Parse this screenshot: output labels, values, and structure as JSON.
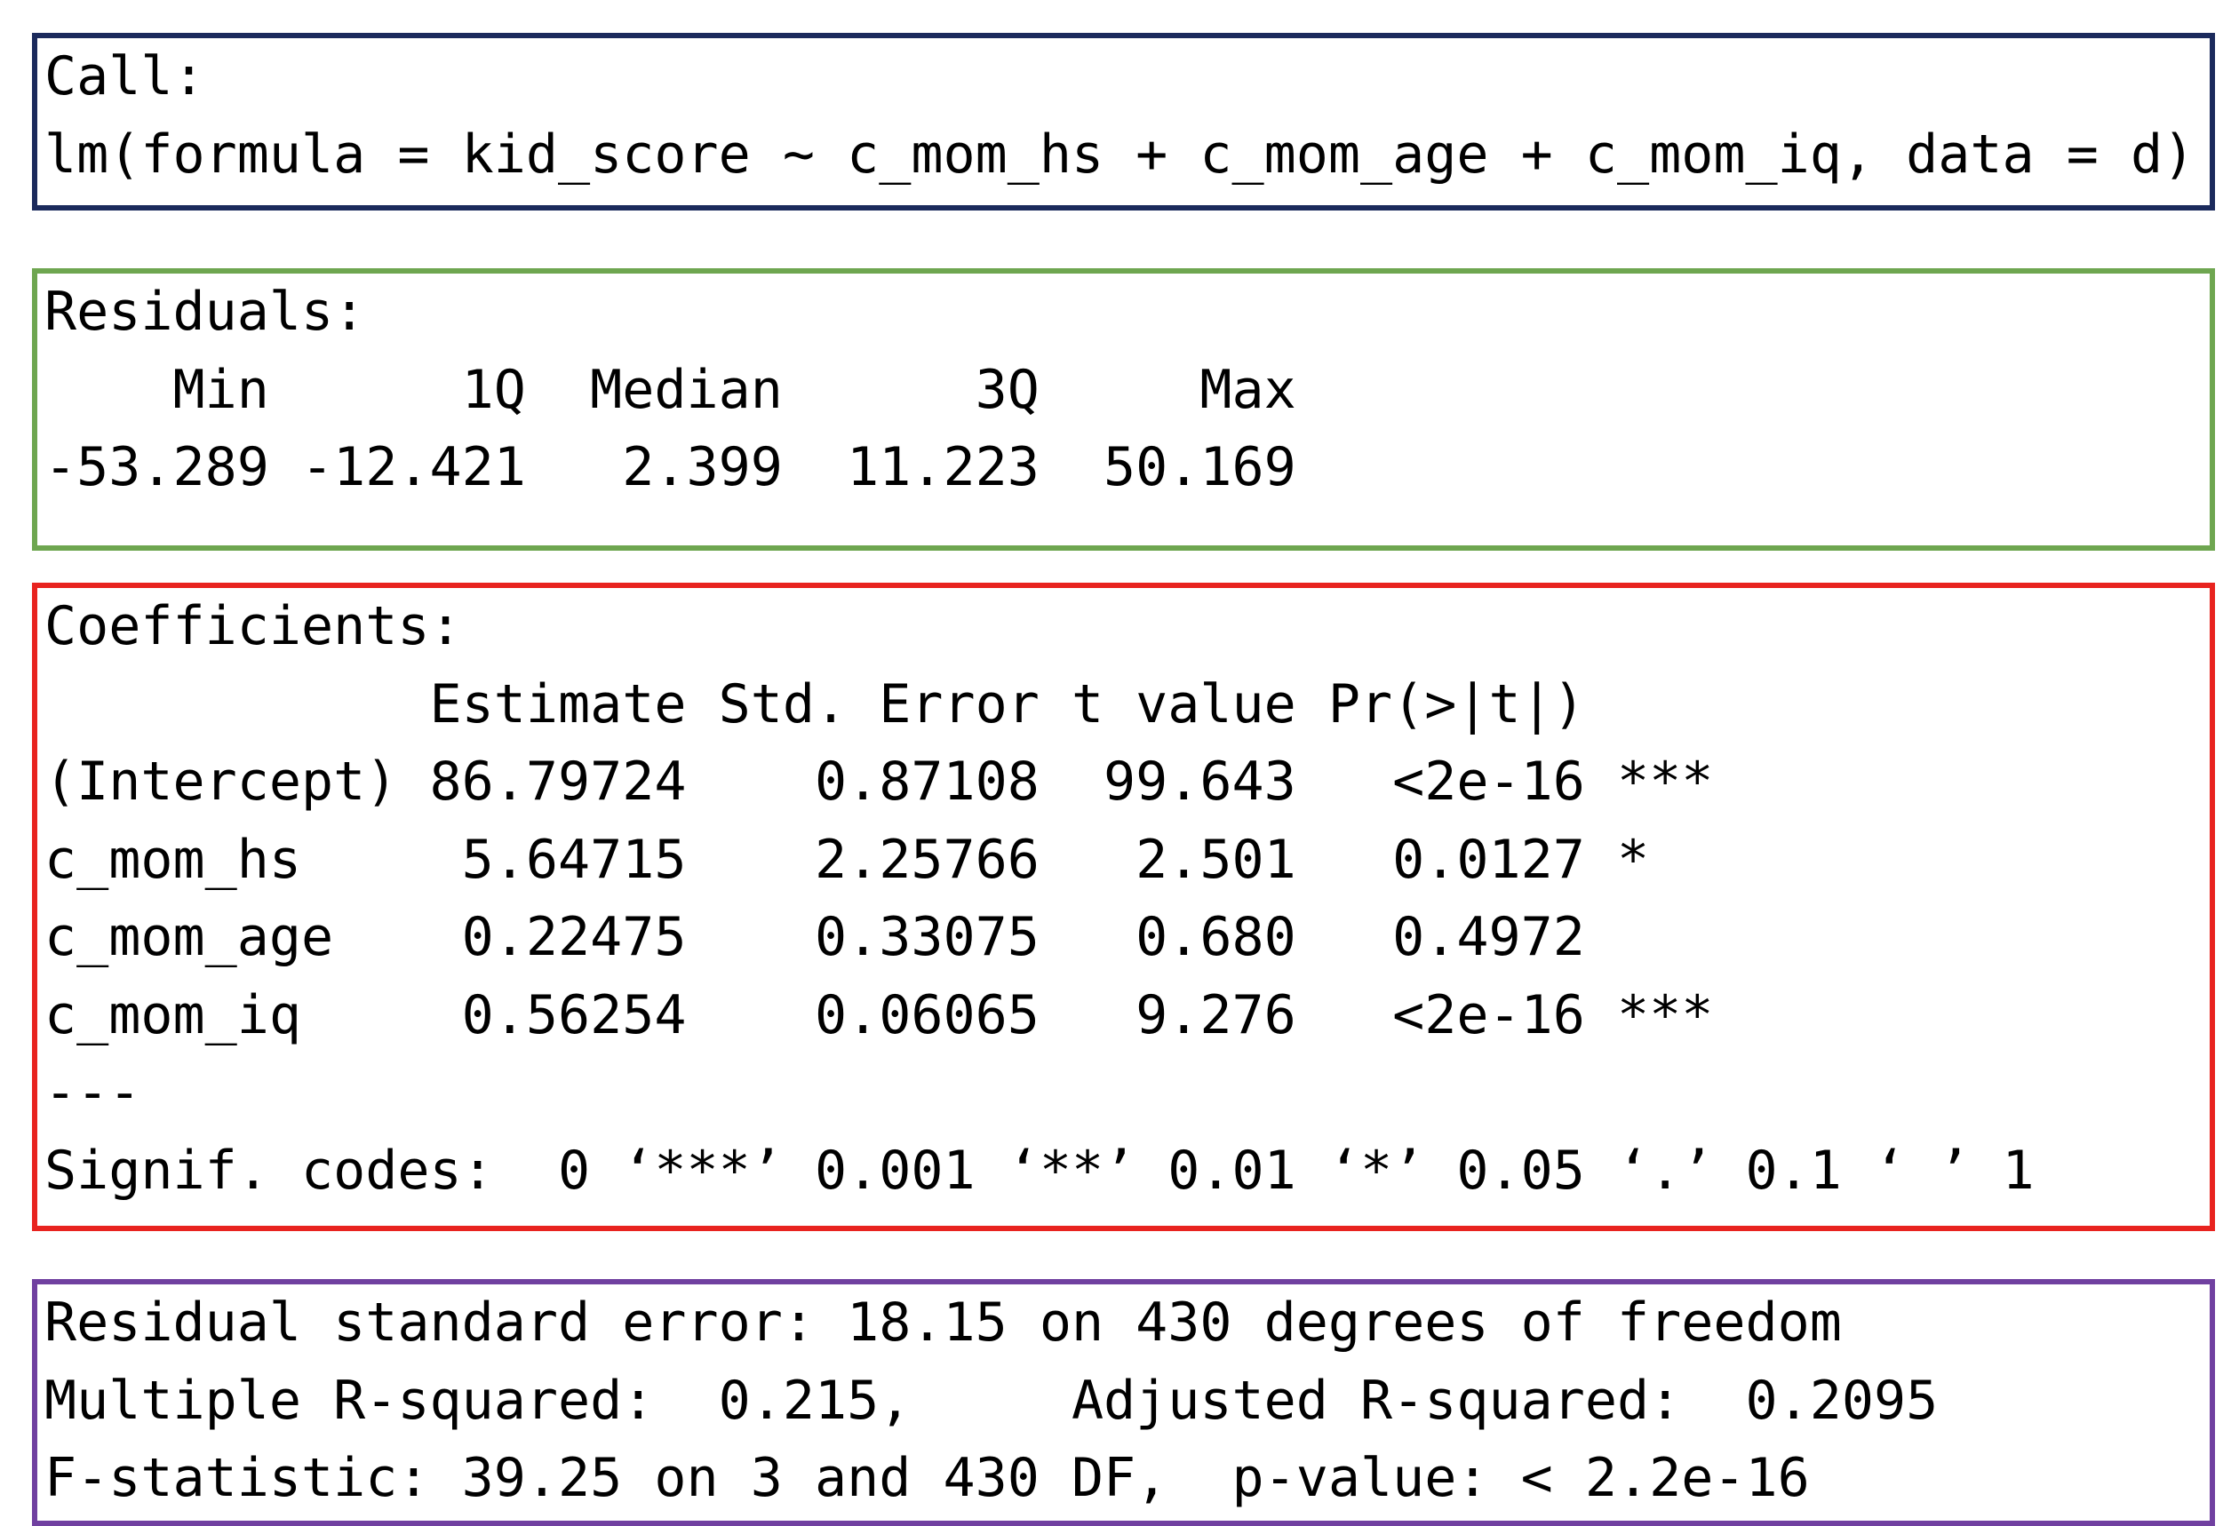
{
  "colors": {
    "call_border": "#1b2a5c",
    "residuals_border": "#6ea650",
    "coefficients_border": "#e8231f",
    "model_stats_border": "#7040a0"
  },
  "call": {
    "heading": "Call:",
    "formula": "lm(formula = kid_score ~ c_mom_hs + c_mom_age + c_mom_iq, data = d)"
  },
  "residuals": {
    "heading": "Residuals:",
    "header_row": "    Min      1Q  Median      3Q     Max ",
    "values_row": "-53.289 -12.421   2.399  11.223  50.169 "
  },
  "coefficients": {
    "heading": "Coefficients:",
    "header_row": "            Estimate Std. Error t value Pr(>|t|)    ",
    "rows": [
      "(Intercept) 86.79724    0.87108  99.643   <2e-16 ***",
      "c_mom_hs     5.64715    2.25766   2.501   0.0127 *  ",
      "c_mom_age    0.22475    0.33075   0.680   0.4972    ",
      "c_mom_iq     0.56254    0.06065   9.276   <2e-16 ***"
    ],
    "separator": "---",
    "signif_codes": "Signif. codes:  0 ‘***’ 0.001 ‘**’ 0.01 ‘*’ 0.05 ‘.’ 0.1 ‘ ’ 1"
  },
  "model_stats": {
    "residual_standard_error": "Residual standard error: 18.15 on 430 degrees of freedom",
    "r_squared": "Multiple R-squared:  0.215,\tAdjusted R-squared:  0.2095 ",
    "f_statistic": "F-statistic: 39.25 on 3 and 430 DF,  p-value: < 2.2e-16"
  }
}
